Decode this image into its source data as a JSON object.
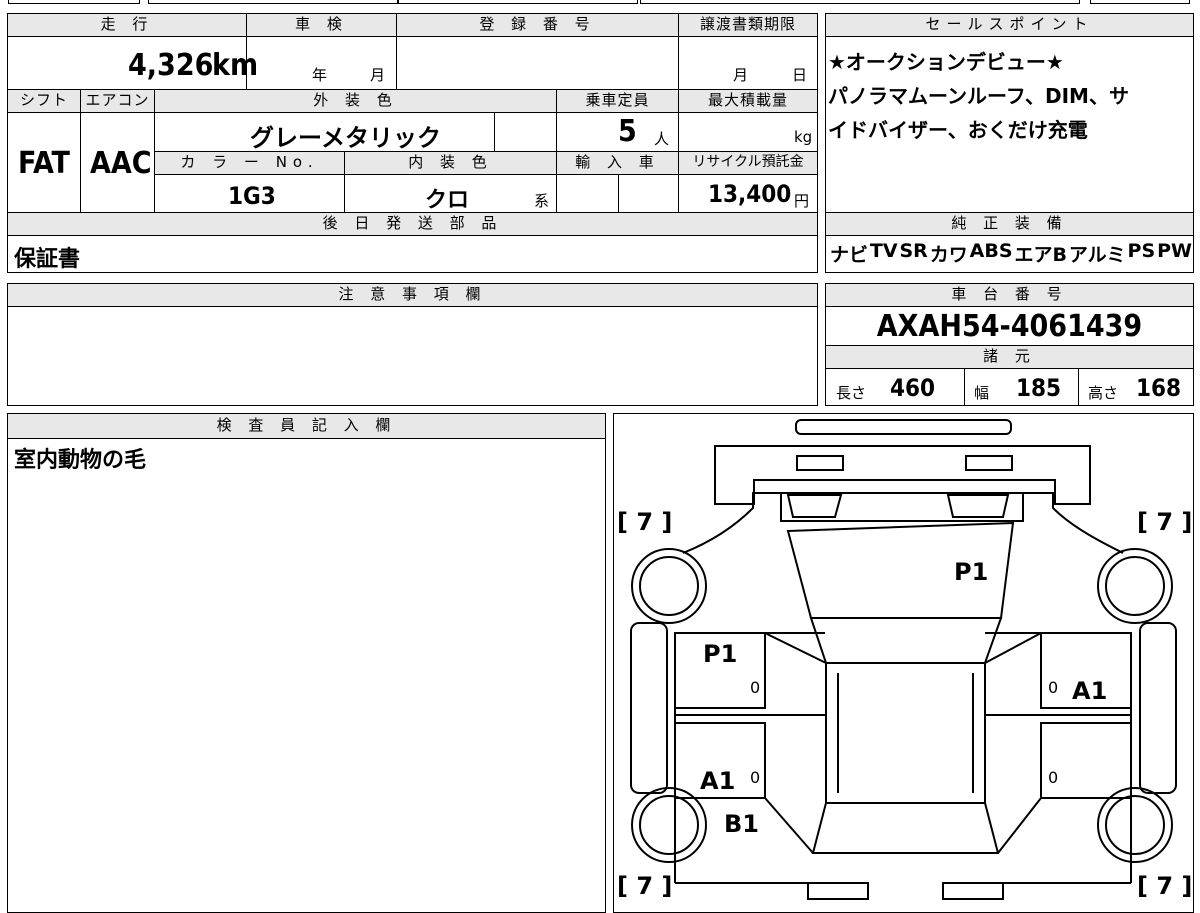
{
  "top": {
    "mileage_label": "走 行",
    "mileage_value": "4,326",
    "mileage_unit": "km",
    "inspection_label": "車 検",
    "year_unit": "年",
    "month_unit": "月",
    "registration_label": "登 録 番 号",
    "transfer_label": "譲渡書類期限",
    "transfer_month": "月",
    "transfer_day": "日"
  },
  "row2": {
    "shift_label": "シフト",
    "shift_value": "FAT",
    "ac_label": "エアコン",
    "ac_value": "AAC",
    "exterior_label": "外 装 色",
    "exterior_value": "グレーメタリック",
    "capacity_label": "乗車定員",
    "capacity_value": "5",
    "capacity_unit": "人",
    "maxload_label": "最大積載量",
    "maxload_unit": "kg",
    "color_no_label": "カ ラ ー No.",
    "color_no_value": "1G3",
    "interior_label": "内 装 色",
    "interior_value": "クロ",
    "interior_suffix": "系",
    "import_label": "輸 入 車",
    "recycle_label": "リサイクル預託金",
    "recycle_value": "13,400",
    "recycle_unit": "円"
  },
  "later_parts": {
    "label": "後 日 発 送 部 品",
    "value": "保証書"
  },
  "notes": {
    "label": "注 意 事 項 欄",
    "value": ""
  },
  "inspector": {
    "label": "検 査 員 記 入 欄",
    "value": "室内動物の毛"
  },
  "sales_point": {
    "label": "セールスポイント",
    "line1": "★オークションデビュー★",
    "line2": "パノラマムーンルーフ、DIM、サ",
    "line3": "イドバイザー、おくだけ充電"
  },
  "equipment": {
    "label": "純 正 装 備",
    "items": [
      "ナビ",
      "TV",
      "SR",
      "カワ",
      "ABS",
      "エアB",
      "アルミ",
      "PS",
      "PW"
    ]
  },
  "chassis": {
    "label": "車 台 番 号",
    "value": "AXAH54-4061439"
  },
  "specs": {
    "label": "諸 元",
    "length_label": "長さ",
    "length_value": "460",
    "width_label": "幅",
    "width_value": "185",
    "height_label": "高さ",
    "height_value": "168"
  },
  "diagram": {
    "tire_fl": "[ 7 ]",
    "tire_fr": "[ 7 ]",
    "tire_rl": "[ 7 ]",
    "tire_rr": "[ 7 ]",
    "hood": "P1",
    "front_left_door": "P1",
    "right_door": "A1",
    "rear_left_door": "A1",
    "rear_left_quarter": "B1",
    "zero": "0"
  }
}
